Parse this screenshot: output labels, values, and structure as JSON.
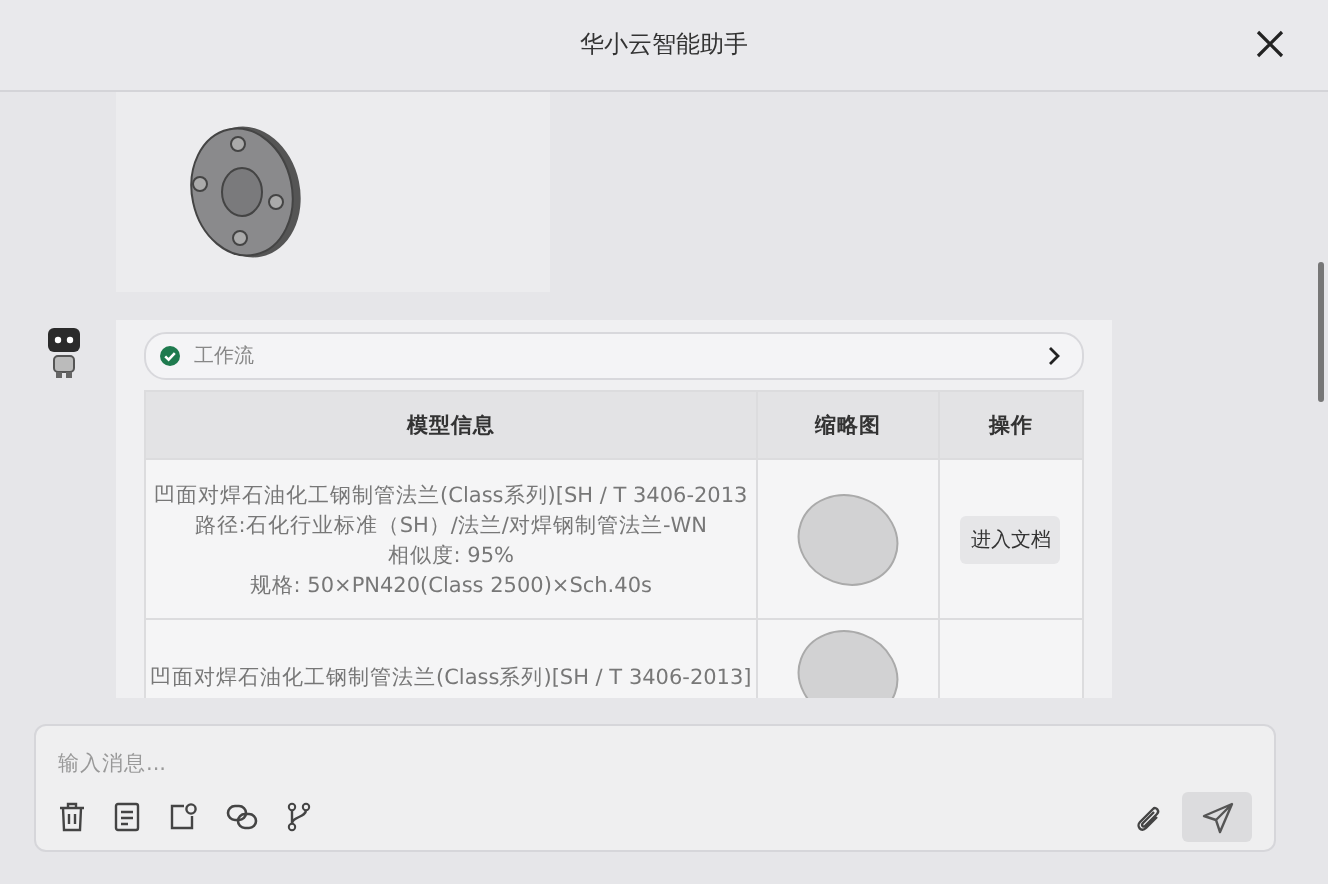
{
  "window": {
    "title": "华小云智能助手"
  },
  "messages": [
    {
      "kind": "image"
    },
    {
      "kind": "result",
      "workflow": {
        "label": "工作流",
        "done": true
      },
      "table": {
        "columns": [
          "模型信息",
          "缩略图",
          "操作"
        ],
        "rows": [
          {
            "lines": [
              "凹面对焊石油化工钢制管法兰(Class系列)[SH / T 3406-2013",
              "路径:石化行业标准（SH）/法兰/对焊钢制管法兰-WN",
              "相似度: 95%",
              "规格: 50×PN420(Class 2500)×Sch.40s"
            ],
            "action": "进入文档"
          },
          {
            "lines": [
              "凹面对焊石油化工钢制管法兰(Class系列)[SH / T 3406-2013]"
            ]
          }
        ]
      }
    }
  ],
  "composer": {
    "placeholder": "输入消息..."
  }
}
